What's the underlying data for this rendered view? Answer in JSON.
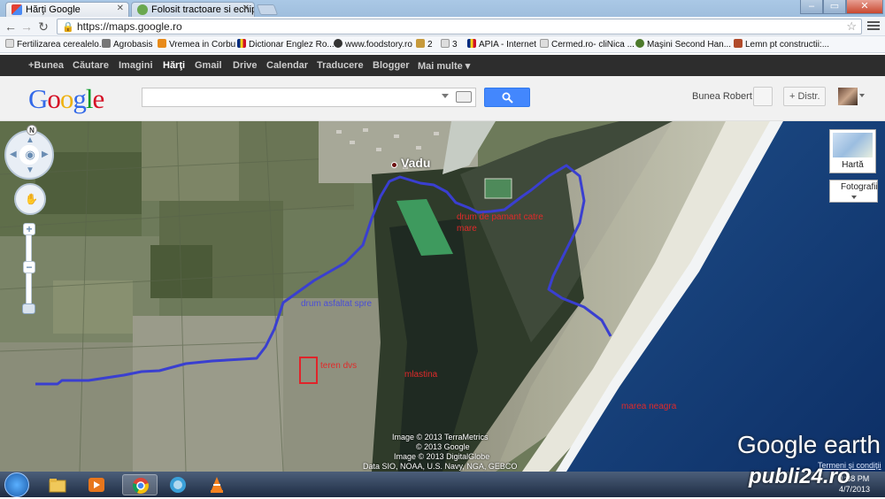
{
  "browser": {
    "tabs": [
      {
        "title": "Hărţi Google",
        "active": true
      },
      {
        "title": "Folosit tractoare si echipa",
        "active": false
      }
    ],
    "url": "https://maps.google.ro",
    "bookmarks": [
      "Fertilizarea cerealelo...",
      "Agrobasis",
      "Vremea in Corbu",
      "Dictionar Englez Ro...",
      "www.foodstory.ro",
      "2",
      "3",
      "APIA - Internet",
      "Cermed.ro- cliNica ...",
      "Maşini Second Han...",
      "Lemn pt constructii:..."
    ]
  },
  "google_bar": {
    "items": [
      "+Bunea",
      "Căutare",
      "Imagini",
      "Hărţi",
      "Gmail",
      "Drive",
      "Calendar",
      "Traducere",
      "Blogger",
      "Mai multe"
    ],
    "active": "Hărţi"
  },
  "header": {
    "logo": "Google",
    "search_value": "",
    "user_name": "Bunea Robert",
    "share_label": "Distr."
  },
  "map": {
    "compass_label": "N",
    "place_name": "Vadu",
    "annotations": {
      "road_asphalt": "drum asfaltat spre",
      "dirt_road": "drum de pamant catre mare",
      "dirt_road_line1": "drum de pamant catre",
      "dirt_road_line2": "mare",
      "land_plot": "teren dvs",
      "marsh": "mlastina",
      "black_sea": "marea neagra"
    },
    "map_type_map": "Hartă",
    "map_type_photo": "Fotografii",
    "attribution": [
      "Image © 2013 TerraMetrics",
      "© 2013 Google",
      "Image © 2013 DigitalGlobe",
      "Data SIO, NOAA, U.S. Navy, NGA, GEBCO"
    ],
    "brand": "Google earth",
    "terms": "Termeni şi condiţii"
  },
  "taskbar": {
    "time": "1:38 PM",
    "date": "4/7/2013"
  },
  "watermark": "publi24.ro",
  "colors": {
    "route": "#3a3fd0",
    "plot": "#e0242a",
    "google_bar": "#2d2d2d",
    "search_button": "#4387fd"
  },
  "icons": [
    "back-icon",
    "forward-icon",
    "reload-icon",
    "lock-icon",
    "star-icon",
    "wrench-icon",
    "search-icon",
    "keyboard-icon",
    "eye-icon",
    "hand-icon",
    "zoom-in-icon",
    "zoom-out-icon",
    "windows-start-icon",
    "folder-icon",
    "media-player-icon",
    "chrome-icon",
    "vlc-icon"
  ]
}
